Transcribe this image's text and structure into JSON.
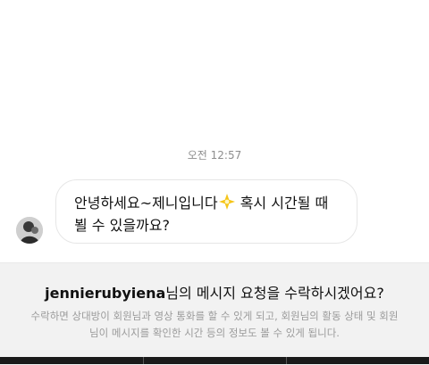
{
  "thread": {
    "timestamp": "오전 12:57"
  },
  "message": {
    "line1_a": "안녕하세요~제니입니다",
    "sparkle_icon": "sparkle-icon",
    "line1_b": " 혹시 시간될 때",
    "line2": "뵐 수 있을까요?"
  },
  "request": {
    "username": "jennierubyiena",
    "title_suffix": "님의 메시지 요청을 수락하시겠어요?",
    "description": "수락하면 상대방이 회원님과 영상 통화를 할 수 있게 되고, 회원님의 활동 상태 및 회원님이 메시지를 확인한 시간 등의 정보도 볼 수 있게 됩니다."
  },
  "colors": {
    "panel_bg": "#f2f2f2",
    "muted_text": "#8e8e8e",
    "bubble_border": "#e6e6e6"
  }
}
